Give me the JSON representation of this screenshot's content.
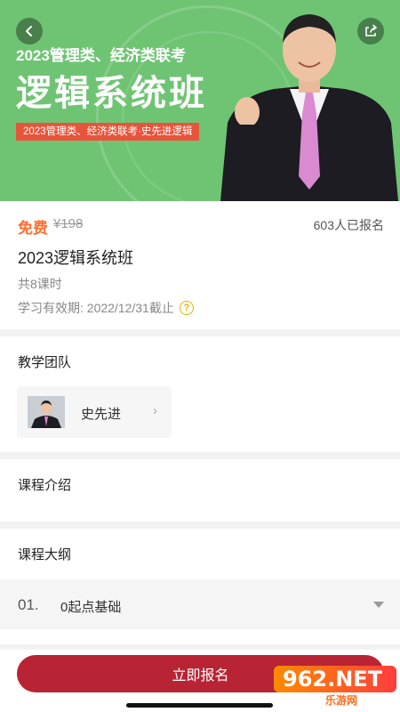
{
  "banner": {
    "subtitle": "2023管理类、经济类联考",
    "title": "逻辑系统班",
    "tag": "2023管理类、经济类联考·史先进逻辑",
    "background_color": "#6fc474"
  },
  "icons": {
    "back": "back-arrow-icon",
    "share": "share-icon",
    "help": "question-circle-icon",
    "chevron": "chevron-right-icon",
    "caret": "caret-down-icon"
  },
  "course": {
    "price_label": "免费",
    "original_price": "¥198",
    "enrolled": "603人已报名",
    "title": "2023逻辑系统班",
    "lessons": "共8课时",
    "validity": "学习有效期: 2022/12/31截止",
    "help_glyph": "?"
  },
  "team": {
    "title": "教学团队",
    "teacher_name": "史先进",
    "chevron": "›"
  },
  "intro": {
    "title": "课程介绍"
  },
  "outline": {
    "title": "课程大纲",
    "items": [
      {
        "number": "01.",
        "label": "0起点基础"
      }
    ]
  },
  "actions": {
    "enroll_label": "立即报名",
    "accent_color": "#b82433"
  },
  "watermark": {
    "mark": "962.NET",
    "text": "乐游网"
  }
}
